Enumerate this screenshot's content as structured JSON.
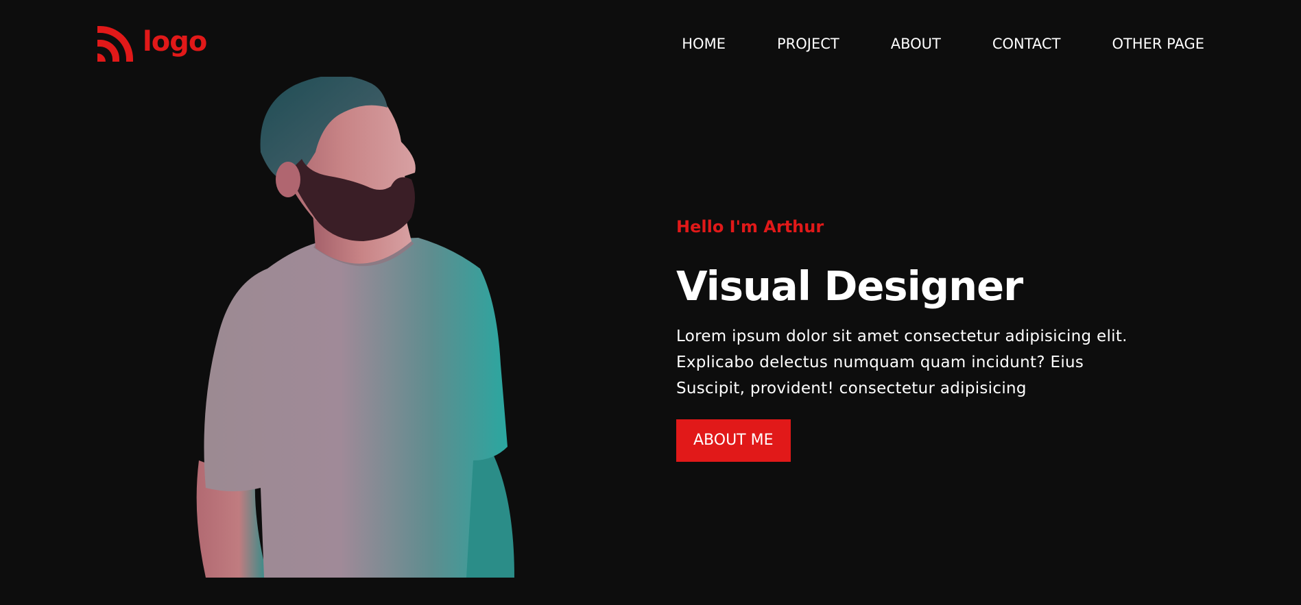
{
  "header": {
    "logo_text": "logo",
    "logo_icon": "rss-feed-icon",
    "nav": [
      {
        "label": "HOME"
      },
      {
        "label": "PROJECT"
      },
      {
        "label": "ABOUT"
      },
      {
        "label": "CONTACT"
      },
      {
        "label": "OTHER PAGE"
      }
    ]
  },
  "hero": {
    "greeting": "Hello I'm Arthur",
    "title": "Visual Designer",
    "description_lines": [
      "Lorem ipsum dolor sit amet consectetur adipisicing elit.",
      "Explicabo delectus numquam quam incidunt? Eius",
      "Suscipit, provident! consectetur adipisicing"
    ],
    "button_label": "ABOUT ME",
    "portrait": "bearded man in grey t-shirt looking upward, pink and teal lighting"
  },
  "colors": {
    "background": "#0d0d0d",
    "accent": "#e11919",
    "text": "#ffffff"
  }
}
